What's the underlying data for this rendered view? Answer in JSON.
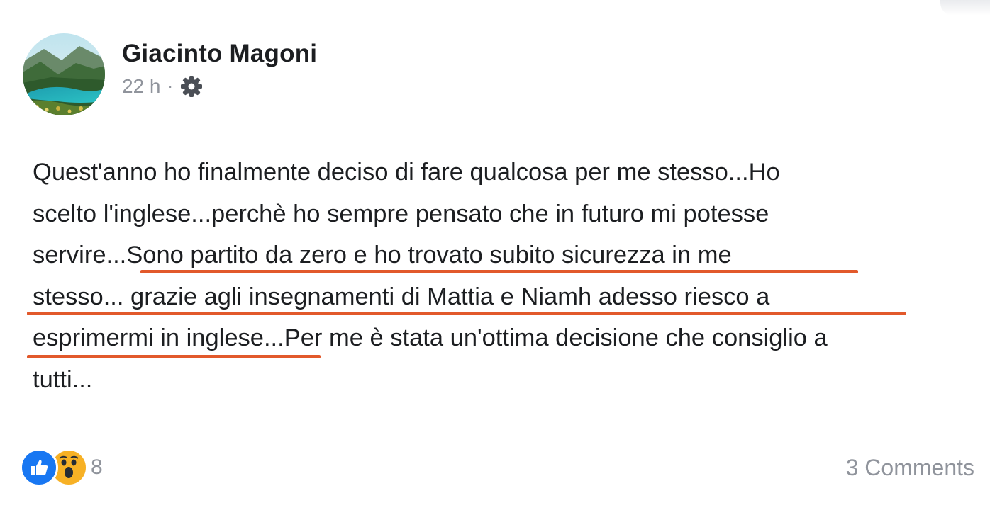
{
  "post": {
    "author": "Giacinto Magoni",
    "time": "22 h",
    "separator": "·",
    "privacy_icon": "gear-icon",
    "text_lines": [
      "Quest'anno ho finalmente deciso di fare qualcosa per me stesso...Ho",
      "scelto l'inglese...perchè ho sempre pensato che in futuro mi potesse",
      "servire...Sono partito da zero e ho trovato subito sicurezza in me",
      "stesso... grazie agli insegnamenti di Mattia e Niamh adesso riesco a",
      "esprimermi in inglese...Per me è stata un'ottima decisione che consiglio a",
      "tutti..."
    ],
    "highlight_color": "#e2592b"
  },
  "footer": {
    "reaction_icons": [
      "like-icon",
      "wow-icon"
    ],
    "reaction_count": "8",
    "comments": "3 Comments"
  },
  "colors": {
    "like_blue": "#1877f2",
    "wow_yellow": "#f7b125",
    "muted_text": "#90949c"
  }
}
